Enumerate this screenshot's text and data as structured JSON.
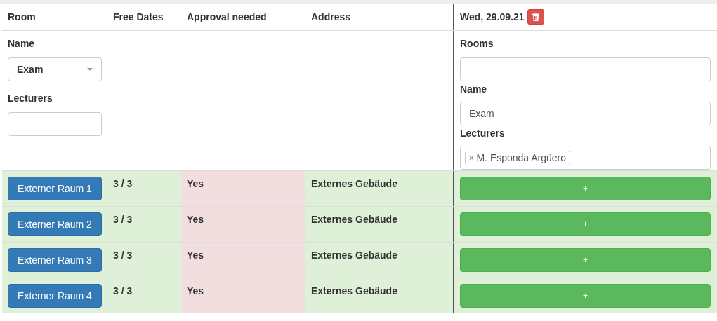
{
  "columns": [
    "Room",
    "Free Dates",
    "Approval needed",
    "Address"
  ],
  "day": {
    "date": "Wed, 29.09.21"
  },
  "filter": {
    "name_label": "Name",
    "name_value": "Exam",
    "lecturers_label": "Lecturers"
  },
  "day_form": {
    "rooms_label": "Rooms",
    "name_label": "Name",
    "name_value": "Exam",
    "lecturers_label": "Lecturers",
    "lecturers": [
      {
        "label": "M. Esponda Argüero",
        "remove": "×"
      }
    ]
  },
  "rows": [
    {
      "room": "Externer Raum 1",
      "free_dates": "3 / 3",
      "approval": "Yes",
      "approval_needed": true,
      "address": "Externes Gebäude",
      "add": "+"
    },
    {
      "room": "Externer Raum 2",
      "free_dates": "3 / 3",
      "approval": "Yes",
      "approval_needed": true,
      "address": "Externes Gebäude",
      "add": "+"
    },
    {
      "room": "Externer Raum 3",
      "free_dates": "3 / 3",
      "approval": "Yes",
      "approval_needed": true,
      "address": "Externes Gebäude",
      "add": "+"
    },
    {
      "room": "Externer Raum 4",
      "free_dates": "3 / 3",
      "approval": "Yes",
      "approval_needed": true,
      "address": "Externes Gebäude",
      "add": "+"
    }
  ]
}
